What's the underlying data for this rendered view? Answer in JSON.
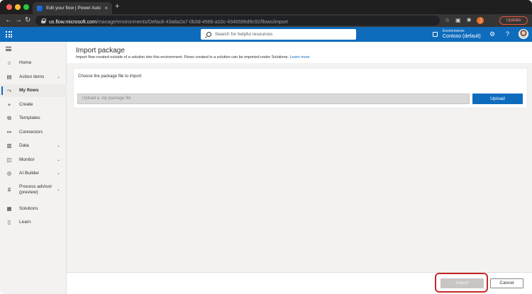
{
  "browser": {
    "tab_title": "Edit your flow | Power Automate",
    "tab_close": "×",
    "new_tab": "+",
    "url_host": "us.flow.microsoft.com",
    "url_path": "/manage/environments/Default-43a8a2a7-0b3d-4566-a10c-4346596d9c92/flows/import",
    "profile_initial": "J",
    "update_label": "Update"
  },
  "appbar": {
    "search_placeholder": "Search for helpful resources",
    "env_label": "Environments",
    "env_name": "Contoso (default)"
  },
  "sidebar": {
    "items": [
      {
        "label": "Home",
        "icon": "home-icon"
      },
      {
        "label": "Action items",
        "icon": "clipboard-icon",
        "chevron": true
      },
      {
        "label": "My flows",
        "icon": "flow-icon",
        "active": true
      },
      {
        "label": "Create",
        "icon": "plus-icon"
      },
      {
        "label": "Templates",
        "icon": "templates-icon"
      },
      {
        "label": "Connectors",
        "icon": "connector-icon"
      },
      {
        "label": "Data",
        "icon": "database-icon",
        "chevron": true
      },
      {
        "label": "Monitor",
        "icon": "monitor-icon",
        "chevron": true
      },
      {
        "label": "AI Builder",
        "icon": "ai-builder-icon",
        "chevron": true
      },
      {
        "label": "Process advisor (preview)",
        "icon": "process-advisor-icon",
        "chevron": true
      },
      {
        "label": "Solutions",
        "icon": "solutions-icon"
      },
      {
        "label": "Learn",
        "icon": "book-icon"
      }
    ]
  },
  "main": {
    "title": "Import package",
    "subtitle": "Import flow created outside of a solution into this environment. Flows created in a solution can be imported under Solutions.",
    "learn_more": "Learn more",
    "choose_label": "Choose the package file to import",
    "file_placeholder": "Upload a .zip package file",
    "upload_label": "Upload",
    "import_label": "Import",
    "cancel_label": "Cancel"
  },
  "colors": {
    "brand": "#0f6cbd",
    "highlight": "#c62828"
  }
}
